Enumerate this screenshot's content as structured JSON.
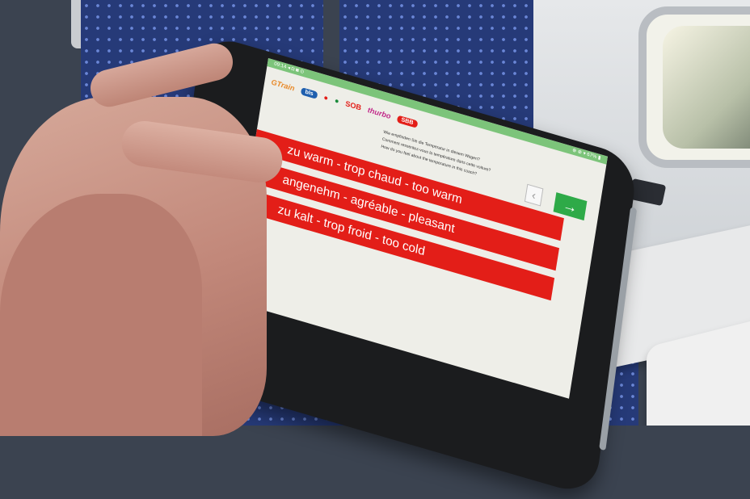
{
  "status_bar": {
    "left_text": "09:14 ◂ ◘ ◙ ⊙",
    "right_text": "⊕ ⊗ ▾ 67% ▮"
  },
  "logos": [
    {
      "label": "GTrain",
      "color": "#e88a2a"
    },
    {
      "label": "bls",
      "color": "#1f5fae"
    },
    {
      "label": "●",
      "color": "#e31e18"
    },
    {
      "label": "●",
      "color": "#1a8a3a"
    },
    {
      "label": "SOB",
      "color": "#e31e18"
    },
    {
      "label": "thurbo",
      "color": "#c22a8a"
    },
    {
      "label": "SBB",
      "color": "#e31e18"
    }
  ],
  "question": {
    "de": "Wie empfinden Sie die Temperatur in diesem Wagen?",
    "fr": "Comment ressentez-vous la température dans cette voiture?",
    "en": "How do you feel about the temperature in this coach?"
  },
  "navigation": {
    "back_icon": "‹",
    "next_icon": "→"
  },
  "options": [
    "zu warm - trop chaud - too warm",
    "angenehm - agréable - pleasant",
    "zu kalt - trop froid - too cold"
  ],
  "colors": {
    "option_red": "#e31e18",
    "next_green": "#2eaa48",
    "status_green": "#7cc47a",
    "screen_bg": "#eeeee8"
  }
}
